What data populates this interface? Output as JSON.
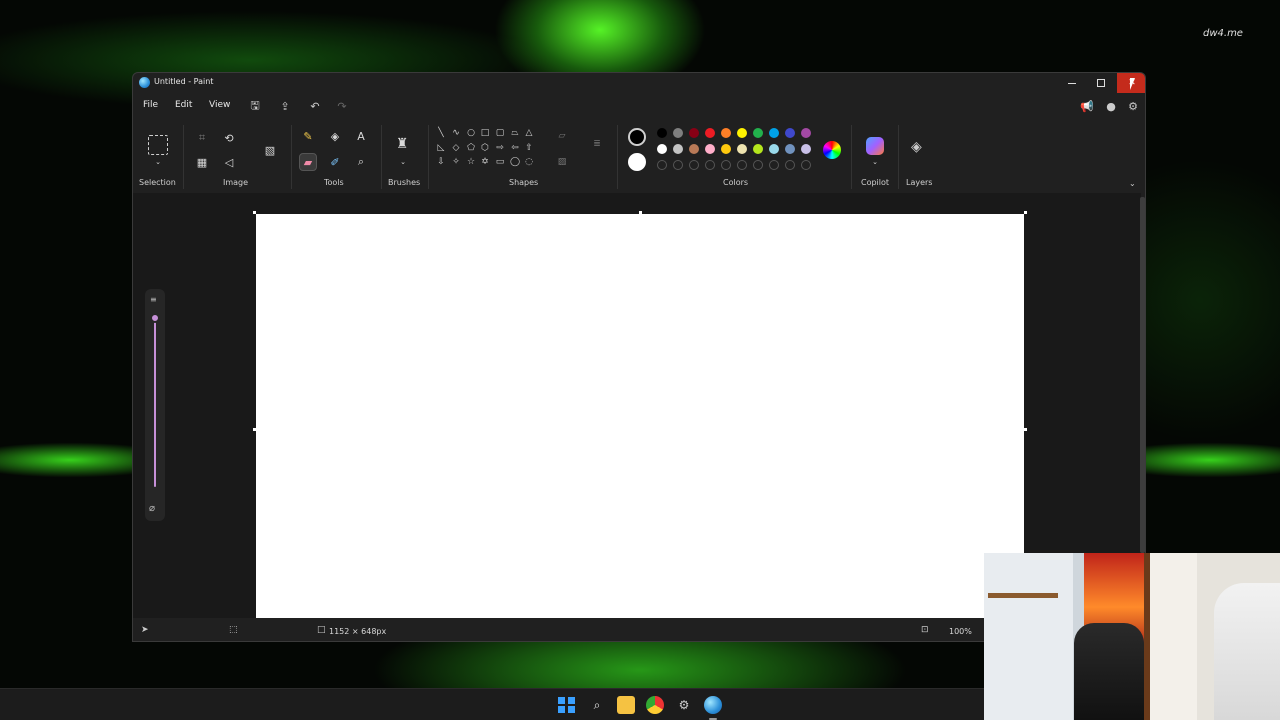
{
  "window": {
    "title": "Untitled - Paint"
  },
  "menu": {
    "file": "File",
    "edit": "Edit",
    "view": "View"
  },
  "ribbon": {
    "groups": {
      "selection": "Selection",
      "image": "Image",
      "tools": "Tools",
      "brushes": "Brushes",
      "shapes": "Shapes",
      "colors": "Colors",
      "copilot": "Copilot",
      "layers": "Layers"
    },
    "palette_row1": [
      "#000000",
      "#7f7f7f",
      "#880015",
      "#ed1c24",
      "#ff7f27",
      "#fff200",
      "#22b14c",
      "#00a2e8",
      "#3f48cc",
      "#a349a4"
    ],
    "palette_row2": [
      "#ffffff",
      "#c3c3c3",
      "#b97a57",
      "#ffaec9",
      "#ffc90e",
      "#efe4b0",
      "#b5e61d",
      "#99d9ea",
      "#7092be",
      "#c8bfe7"
    ],
    "primary_color": "#000000",
    "secondary_color": "#ffffff"
  },
  "status": {
    "canvas_size": "1152 × 648px",
    "zoom": "100%"
  },
  "desktop": {
    "watermark": "dw4.me"
  },
  "colors": {
    "accent": "#c690d8",
    "close_button": "#c42b1c"
  }
}
